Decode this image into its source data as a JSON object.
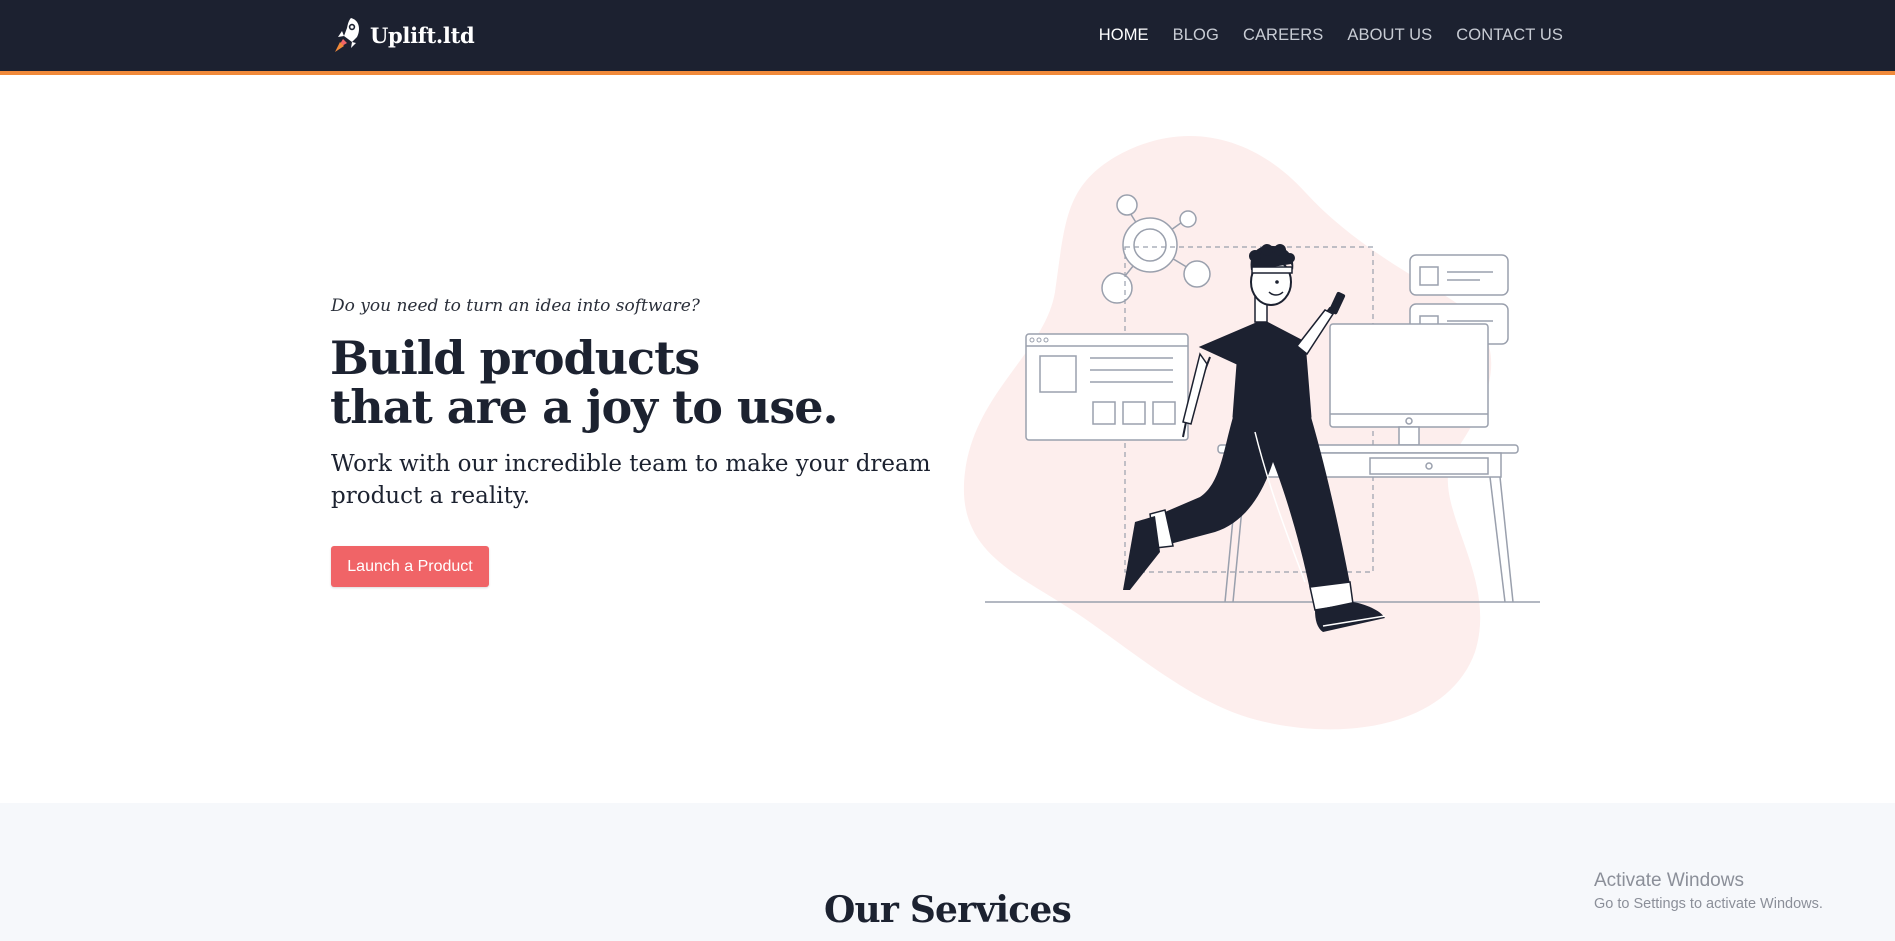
{
  "brand": {
    "name": "Uplift.ltd",
    "logo_icon": "rocket-icon"
  },
  "nav": {
    "items": [
      {
        "label": "HOME",
        "active": true
      },
      {
        "label": "BLOG",
        "active": false
      },
      {
        "label": "CAREERS",
        "active": false
      },
      {
        "label": "ABOUT US",
        "active": false
      },
      {
        "label": "CONTACT US",
        "active": false
      }
    ]
  },
  "hero": {
    "eyebrow": "Do you need to turn an idea into software?",
    "title_line1": "Build products",
    "title_line2": "that are a joy to use.",
    "subtitle": "Work with our incredible team to make your dream product a reality.",
    "cta_label": "Launch a Product",
    "illustration": "person-running-with-phone-illustration"
  },
  "services": {
    "title": "Our Services"
  },
  "watermark": {
    "title": "Activate Windows",
    "subtitle": "Go to Settings to activate Windows."
  },
  "colors": {
    "header_bg": "#1c2130",
    "header_accent": "#f0893a",
    "cta": "#f06467",
    "blob": "#fdeeed",
    "services_bg": "#f6f8fb",
    "text": "#1c2230"
  }
}
